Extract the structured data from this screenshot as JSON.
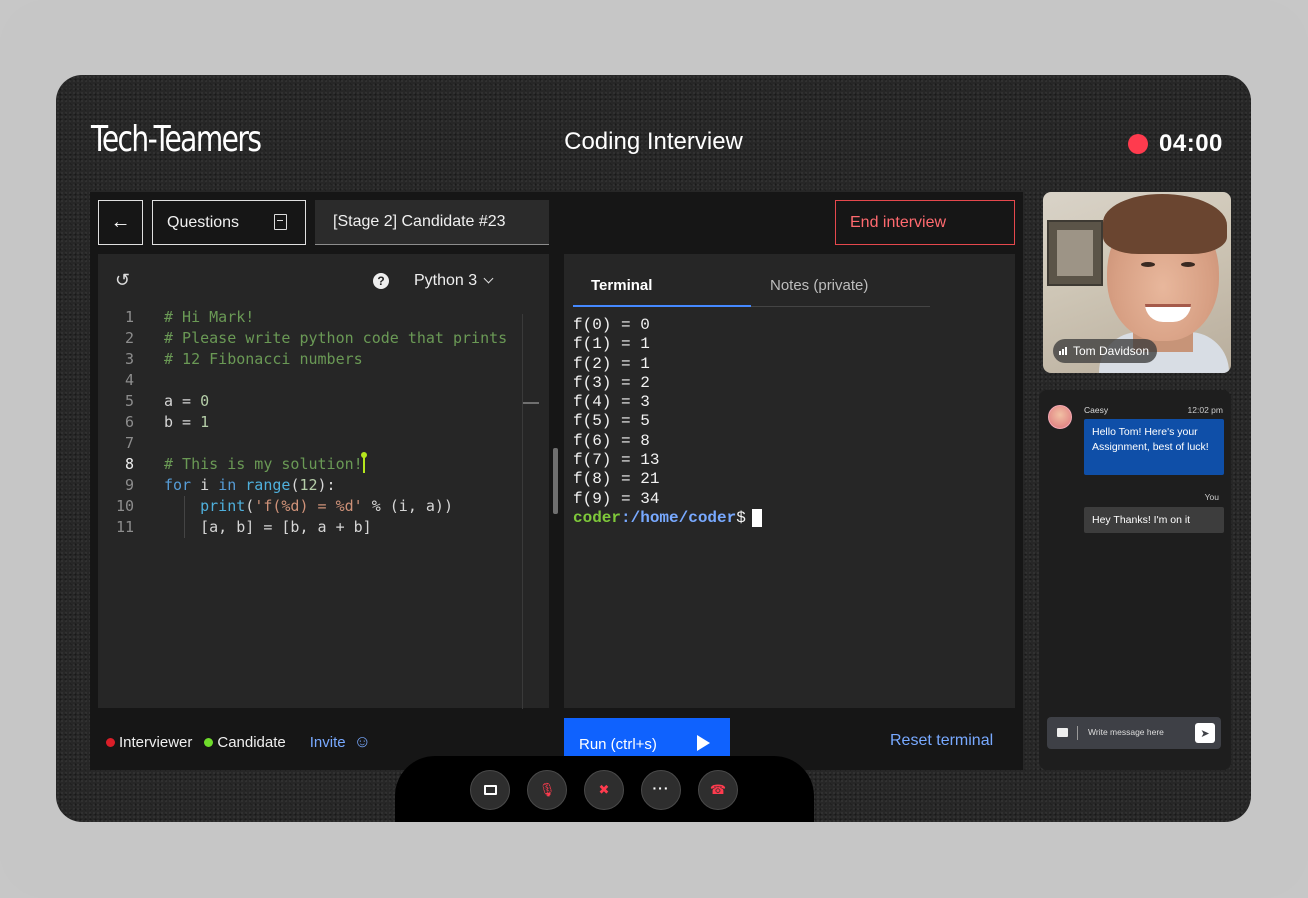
{
  "header": {
    "logo": "Tech-Teamers",
    "title": "Coding Interview",
    "timer": "04:00",
    "record_color": "#ff3b4e"
  },
  "toolbar": {
    "back_icon": "arrow-left-icon",
    "back_glyph": "←",
    "questions_label": "Questions",
    "stage_tab_label": "[Stage 2] Candidate #23",
    "end_interview_label": "End interview"
  },
  "editor": {
    "undo_glyph": "↺",
    "help_glyph": "?",
    "language": "Python 3",
    "active_line": 8,
    "lines": [
      {
        "n": "1",
        "text": "# Hi Mark!"
      },
      {
        "n": "2",
        "text": "# Please write python code that prints"
      },
      {
        "n": "3",
        "text": "# 12 Fibonacci numbers"
      },
      {
        "n": "4",
        "text": ""
      },
      {
        "n": "5",
        "text": "a = 0"
      },
      {
        "n": "6",
        "text": "b = 1"
      },
      {
        "n": "7",
        "text": ""
      },
      {
        "n": "8",
        "text": "# This is my solution!"
      },
      {
        "n": "9",
        "text": "for i in range(12):"
      },
      {
        "n": "10",
        "text": "    print('f(%d) = %d' % (i, a))"
      },
      {
        "n": "11",
        "text": "    [a, b] = [b, a + b]"
      }
    ]
  },
  "terminal": {
    "tab_terminal": "Terminal",
    "tab_notes": "Notes (private)",
    "output": [
      "f(0) = 0",
      "f(1) = 1",
      "f(2) = 1",
      "f(3) = 2",
      "f(4) = 3",
      "f(5) = 5",
      "f(6) = 8",
      "f(7) = 13",
      "f(8) = 21",
      "f(9) = 34"
    ],
    "prompt_user": "coder",
    "prompt_path": ":/home/coder",
    "prompt_symbol": "$"
  },
  "footer": {
    "interviewer_label": "Interviewer",
    "candidate_label": "Candidate",
    "invite_label": "Invite",
    "invite_glyph": "☺",
    "run_label": "Run (ctrl+s)",
    "reset_label": "Reset terminal"
  },
  "call_controls": {
    "mic_glyph": "🎙",
    "camera_glyph": "✖",
    "more_glyph": "···",
    "hangup_glyph": "☎"
  },
  "video": {
    "participant_name": "Tom Davidson"
  },
  "chat": {
    "sender": "Caesy",
    "time": "12:02 pm",
    "incoming_message": "Hello Tom! Here's your Assignment, best of luck!",
    "you_label": "You",
    "outgoing_message": "Hey Thanks! I'm on it",
    "input_placeholder": "Write message here",
    "send_glyph": "➤"
  }
}
